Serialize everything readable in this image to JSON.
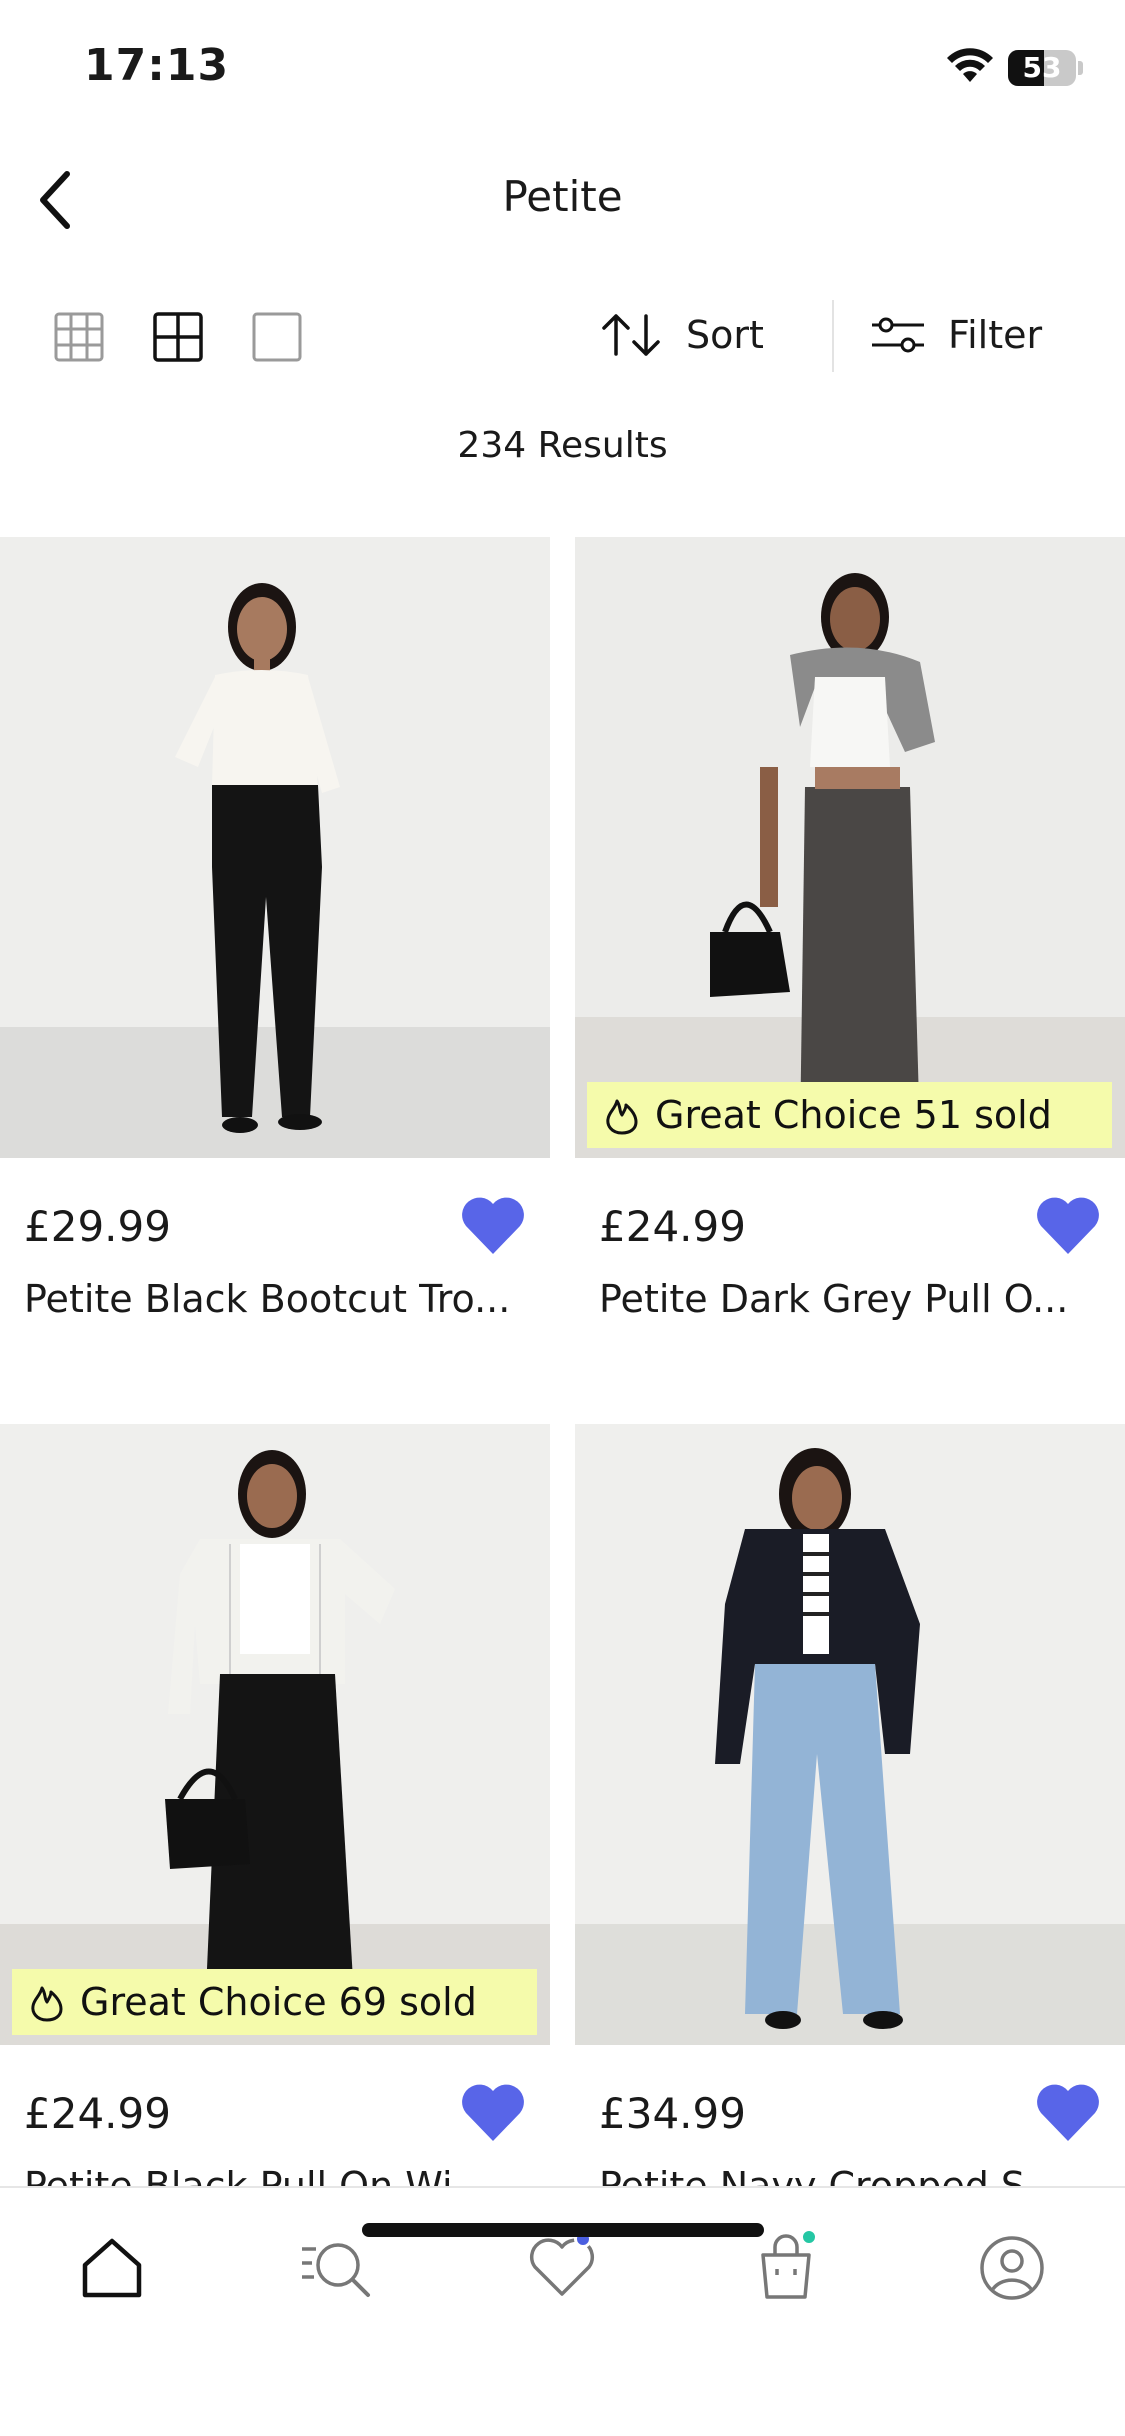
{
  "status_bar": {
    "time": "17:13",
    "battery": "53",
    "battery_level": 0.53
  },
  "header": {
    "title": "Petite",
    "back_icon": "chevron-left-icon"
  },
  "toolbar": {
    "view_options": [
      "grid-3-icon",
      "grid-2-icon",
      "grid-1-icon"
    ],
    "selected_view": "grid-2-icon",
    "sort_label": "Sort",
    "filter_label": "Filter"
  },
  "results": {
    "label": "234 Results"
  },
  "products": [
    {
      "price": "£29.99",
      "name": "Petite Black Bootcut Tro...",
      "badge": "",
      "favorited": true
    },
    {
      "price": "£24.99",
      "name": "Petite Dark Grey Pull O...",
      "badge": "Great Choice 51 sold",
      "favorited": true
    },
    {
      "price": "£24.99",
      "name": "Petite Black Pull On Wi...",
      "badge": "Great Choice 69 sold",
      "favorited": true
    },
    {
      "price": "£34.99",
      "name": "Petite Navy Cropped S...",
      "badge": "",
      "favorited": true
    }
  ],
  "bottom_nav": {
    "items": [
      "home-icon",
      "search-icon",
      "heart-icon",
      "bag-icon",
      "profile-icon"
    ],
    "active": "home-icon"
  },
  "colors": {
    "accent": "#5865e8",
    "badge_bg": "#f5fbab",
    "nav_dot_wishlist": "#4b5fe0",
    "nav_dot_bag": "#25c7a4"
  }
}
